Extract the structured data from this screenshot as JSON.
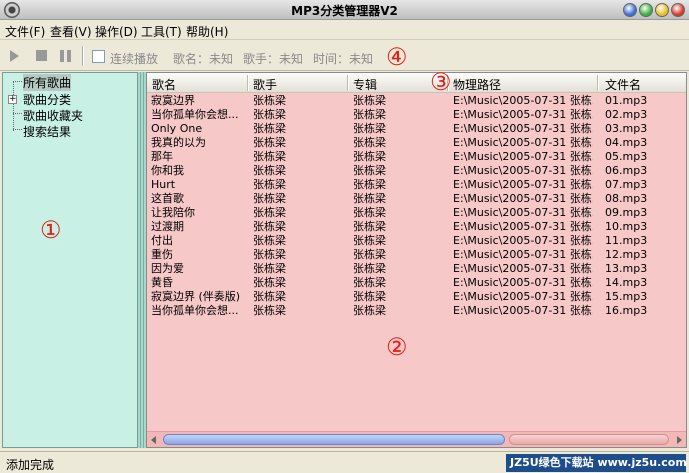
{
  "window": {
    "title": "MP3分类管理器V2"
  },
  "menu": [
    "文件(F)",
    "查看(V)",
    "操作(D)",
    "工具(T)",
    "帮助(H)"
  ],
  "toolbar": {
    "continuous_label": "连续播放",
    "song_label": "歌名：未知",
    "artist_label": "歌手：未知",
    "time_label": "时间：未知"
  },
  "tree": {
    "items": [
      "所有歌曲",
      "歌曲分类",
      "歌曲收藏夹",
      "搜索结果"
    ]
  },
  "columns": [
    "歌名",
    "歌手",
    "专辑",
    "物理路径",
    "文件名"
  ],
  "rows": [
    {
      "title": "寂寞边界",
      "artist": "张栋梁",
      "album": "张栋梁",
      "path": "E:\\Music\\2005-07-31 张栋...",
      "file": "01.mp3"
    },
    {
      "title": "当你孤单你会想...",
      "artist": "张栋梁",
      "album": "张栋梁",
      "path": "E:\\Music\\2005-07-31 张栋...",
      "file": "02.mp3"
    },
    {
      "title": "Only One",
      "artist": "张栋梁",
      "album": "张栋梁",
      "path": "E:\\Music\\2005-07-31 张栋...",
      "file": "03.mp3"
    },
    {
      "title": "我真的以为",
      "artist": "张栋梁",
      "album": "张栋梁",
      "path": "E:\\Music\\2005-07-31 张栋...",
      "file": "04.mp3"
    },
    {
      "title": "那年",
      "artist": "张栋梁",
      "album": "张栋梁",
      "path": "E:\\Music\\2005-07-31 张栋...",
      "file": "05.mp3"
    },
    {
      "title": "你和我",
      "artist": "张栋梁",
      "album": "张栋梁",
      "path": "E:\\Music\\2005-07-31 张栋...",
      "file": "06.mp3"
    },
    {
      "title": "Hurt",
      "artist": "张栋梁",
      "album": "张栋梁",
      "path": "E:\\Music\\2005-07-31 张栋...",
      "file": "07.mp3"
    },
    {
      "title": "这首歌",
      "artist": "张栋梁",
      "album": "张栋梁",
      "path": "E:\\Music\\2005-07-31 张栋...",
      "file": "08.mp3"
    },
    {
      "title": "让我陪你",
      "artist": "张栋梁",
      "album": "张栋梁",
      "path": "E:\\Music\\2005-07-31 张栋...",
      "file": "09.mp3"
    },
    {
      "title": "过渡期",
      "artist": "张栋梁",
      "album": "张栋梁",
      "path": "E:\\Music\\2005-07-31 张栋...",
      "file": "10.mp3"
    },
    {
      "title": "付出",
      "artist": "张栋梁",
      "album": "张栋梁",
      "path": "E:\\Music\\2005-07-31 张栋...",
      "file": "11.mp3"
    },
    {
      "title": "重伤",
      "artist": "张栋梁",
      "album": "张栋梁",
      "path": "E:\\Music\\2005-07-31 张栋...",
      "file": "12.mp3"
    },
    {
      "title": "因为爱",
      "artist": "张栋梁",
      "album": "张栋梁",
      "path": "E:\\Music\\2005-07-31 张栋...",
      "file": "13.mp3"
    },
    {
      "title": "黄昏",
      "artist": "张栋梁",
      "album": "张栋梁",
      "path": "E:\\Music\\2005-07-31 张栋...",
      "file": "14.mp3"
    },
    {
      "title": "寂寞边界 (伴奏版)",
      "artist": "张栋梁",
      "album": "张栋梁",
      "path": "E:\\Music\\2005-07-31 张栋...",
      "file": "15.mp3"
    },
    {
      "title": "当你孤单你会想...",
      "artist": "张栋梁",
      "album": "张栋梁",
      "path": "E:\\Music\\2005-07-31 张栋...",
      "file": "16.mp3"
    }
  ],
  "annotations": [
    "①",
    "②",
    "③",
    "④"
  ],
  "status": {
    "text": "添加完成"
  },
  "watermark": "JZ5U绿色下载站 www.jz5u.com",
  "colors": {
    "tree_bg": "#c8f0e4",
    "list_bg": "#f7c8c8",
    "annotation": "#e0201a"
  }
}
